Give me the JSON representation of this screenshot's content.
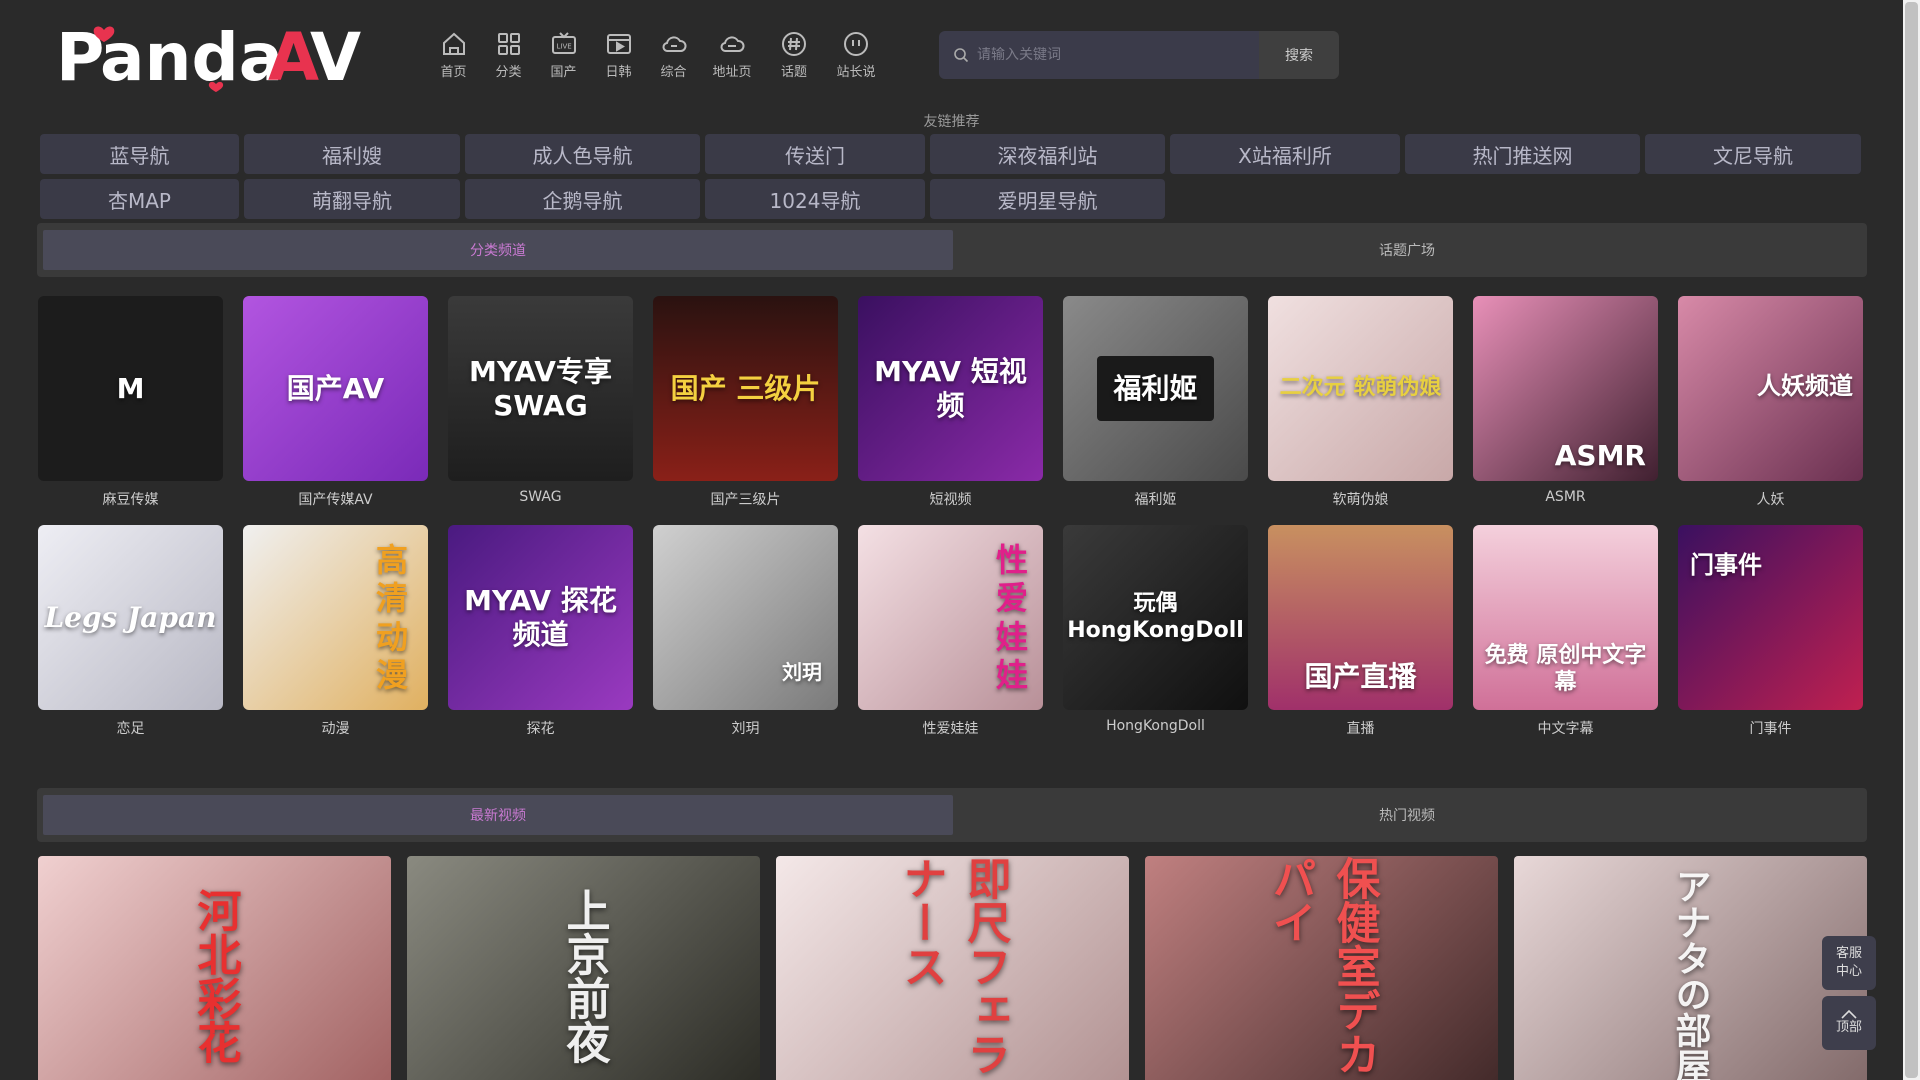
{
  "header": {
    "logo_text": "PandaAV",
    "nav": [
      {
        "label": "首页",
        "icon": "home-icon"
      },
      {
        "label": "分类",
        "icon": "grid-icon"
      },
      {
        "label": "国产",
        "icon": "live-tv-icon"
      },
      {
        "label": "日韩",
        "icon": "video-play-icon"
      },
      {
        "label": "综合",
        "icon": "cloud-icon"
      },
      {
        "label": "地址页",
        "icon": "cloud-link-icon"
      },
      {
        "label": "话题",
        "icon": "hashtag-icon"
      },
      {
        "label": "站长说",
        "icon": "chat-face-icon"
      }
    ],
    "search": {
      "placeholder": "请输入关键词",
      "button": "搜索"
    }
  },
  "friend_links": {
    "title": "友链推荐",
    "row1": [
      "蓝导航",
      "福利嫂",
      "成人色导航",
      "传送门",
      "深夜福利站",
      "X站福利所",
      "热门推送网",
      "文尼导航"
    ],
    "row2": [
      "杏MAP",
      "萌翻导航",
      "企鹅导航",
      "1024导航",
      "爱明星导航"
    ]
  },
  "category_tabs": {
    "active": "分类频道",
    "inactive": "话题广场"
  },
  "categories": {
    "row1": [
      {
        "name": "麻豆传媒",
        "thumb_text": "M",
        "color": "#1c1c1c"
      },
      {
        "name": "国产传媒AV",
        "thumb_text": "国产AV",
        "color": "#9b3fd1"
      },
      {
        "name": "SWAG",
        "thumb_text": "MYAV专享 SWAG",
        "color": "#2b2b2b"
      },
      {
        "name": "国产三级片",
        "thumb_text": "国产 三级片",
        "color": "#5a1410"
      },
      {
        "name": "短视频",
        "thumb_text": "MYAV 短视频",
        "color": "#5a1a7a"
      },
      {
        "name": "福利姬",
        "thumb_text": "福利姬",
        "color": "#6b6b6b"
      },
      {
        "name": "软萌伪娘",
        "thumb_text": "二次元 软萌伪娘",
        "color": "#e0c8c8"
      },
      {
        "name": "ASMR",
        "thumb_text": "ASMR",
        "color": "#c05a90"
      },
      {
        "name": "人妖",
        "thumb_text": "人妖频道",
        "color": "#a0607a"
      }
    ],
    "row2": [
      {
        "name": "恋足",
        "thumb_text": "Legs Japan",
        "color": "#d8d8e0"
      },
      {
        "name": "动漫",
        "thumb_text": "高清 动漫",
        "color": "#e8a040"
      },
      {
        "name": "探花",
        "thumb_text": "MYAV 探花频道",
        "color": "#6a2aa0"
      },
      {
        "name": "刘玥",
        "thumb_text": "刘玥",
        "color": "#b0b0b0"
      },
      {
        "name": "性爱娃娃",
        "thumb_text": "性爱娃娃",
        "color": "#e8c0c8"
      },
      {
        "name": "HongKongDoll",
        "thumb_text": "玩偶 HongKongDoll",
        "color": "#2a2a2a"
      },
      {
        "name": "直播",
        "thumb_text": "国产直播",
        "color": "#b83a7a"
      },
      {
        "name": "中文字幕",
        "thumb_text": "免费 原创中文字幕",
        "color": "#e0a8c0"
      },
      {
        "name": "门事件",
        "thumb_text": "门事件",
        "color": "#6a1a7a"
      }
    ]
  },
  "video_tabs": {
    "active": "最新视频",
    "inactive": "热门视频"
  },
  "videos": [
    {
      "text": "河北彩花",
      "color": "#c89090"
    },
    {
      "text": "上京前夜",
      "color": "#5a5a50"
    },
    {
      "text": "即尺フェラナース",
      "color": "#d0b8b8"
    },
    {
      "text": "保健室デカパイ",
      "color": "#704848"
    },
    {
      "text": "アナタの部屋",
      "color": "#b8a0a0"
    }
  ],
  "float_buttons": {
    "service": "客服中心",
    "top": "顶部"
  }
}
